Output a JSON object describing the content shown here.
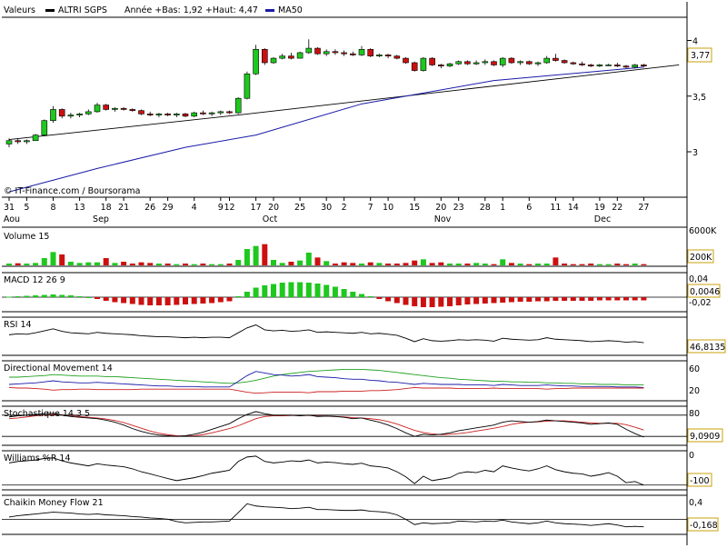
{
  "chart_data": {
    "type": "candlestick",
    "header": {
      "label": "Valeurs",
      "instrument": "ALTRI SGPS",
      "range_text": "Année +Bas: 1,92 +Haut: 4,47",
      "ma_label": "MA50"
    },
    "credit": "© IT-Finance.com / Boursorama",
    "colors": {
      "up": "#1ec81e",
      "down": "#cc1010",
      "ma": "#1a1aa8",
      "red_line": "#cc2020",
      "green_line": "#20a020"
    },
    "x_ticks": [
      "31",
      "5",
      "8",
      "13",
      "18",
      "21",
      "26",
      "29",
      "4",
      "9",
      "12",
      "17",
      "20",
      "25",
      "30",
      "2",
      "7",
      "10",
      "15",
      "20",
      "23",
      "28",
      "1",
      "6",
      "11",
      "14",
      "19",
      "22",
      "27"
    ],
    "months": [
      "Aou",
      "Sep",
      "Oct",
      "Nov",
      "Dec"
    ],
    "price": {
      "y_ticks": [
        "4",
        "3,5",
        "3"
      ],
      "ylim": [
        2.6,
        4.2
      ],
      "last_value": "3,77",
      "candles": [
        [
          3.07,
          3.12,
          3.04,
          3.1
        ],
        [
          3.1,
          3.12,
          3.07,
          3.09
        ],
        [
          3.09,
          3.11,
          3.07,
          3.1
        ],
        [
          3.1,
          3.16,
          3.1,
          3.15
        ],
        [
          3.15,
          3.29,
          3.14,
          3.28
        ],
        [
          3.28,
          3.41,
          3.26,
          3.38
        ],
        [
          3.38,
          3.39,
          3.3,
          3.32
        ],
        [
          3.32,
          3.35,
          3.3,
          3.33
        ],
        [
          3.33,
          3.35,
          3.31,
          3.34
        ],
        [
          3.34,
          3.38,
          3.33,
          3.36
        ],
        [
          3.36,
          3.44,
          3.35,
          3.42
        ],
        [
          3.42,
          3.43,
          3.37,
          3.38
        ],
        [
          3.38,
          3.4,
          3.36,
          3.39
        ],
        [
          3.39,
          3.4,
          3.37,
          3.38
        ],
        [
          3.38,
          3.39,
          3.36,
          3.37
        ],
        [
          3.37,
          3.38,
          3.33,
          3.34
        ],
        [
          3.34,
          3.36,
          3.32,
          3.33
        ],
        [
          3.33,
          3.35,
          3.31,
          3.34
        ],
        [
          3.34,
          3.35,
          3.32,
          3.33
        ],
        [
          3.33,
          3.35,
          3.31,
          3.34
        ],
        [
          3.34,
          3.35,
          3.31,
          3.32
        ],
        [
          3.32,
          3.36,
          3.31,
          3.35
        ],
        [
          3.35,
          3.37,
          3.33,
          3.34
        ],
        [
          3.34,
          3.36,
          3.32,
          3.35
        ],
        [
          3.35,
          3.37,
          3.33,
          3.36
        ],
        [
          3.36,
          3.37,
          3.34,
          3.35
        ],
        [
          3.35,
          3.49,
          3.34,
          3.48
        ],
        [
          3.48,
          3.72,
          3.47,
          3.7
        ],
        [
          3.7,
          3.96,
          3.69,
          3.92
        ],
        [
          3.92,
          3.93,
          3.78,
          3.8
        ],
        [
          3.8,
          3.85,
          3.79,
          3.84
        ],
        [
          3.84,
          3.88,
          3.83,
          3.86
        ],
        [
          3.86,
          3.89,
          3.83,
          3.84
        ],
        [
          3.84,
          3.9,
          3.84,
          3.89
        ],
        [
          3.89,
          4.01,
          3.88,
          3.93
        ],
        [
          3.93,
          3.94,
          3.87,
          3.88
        ],
        [
          3.88,
          3.92,
          3.86,
          3.9
        ],
        [
          3.9,
          3.92,
          3.87,
          3.89
        ],
        [
          3.89,
          3.91,
          3.86,
          3.88
        ],
        [
          3.88,
          3.9,
          3.86,
          3.87
        ],
        [
          3.87,
          3.95,
          3.86,
          3.92
        ],
        [
          3.92,
          3.93,
          3.85,
          3.86
        ],
        [
          3.86,
          3.88,
          3.85,
          3.87
        ],
        [
          3.87,
          3.88,
          3.84,
          3.86
        ],
        [
          3.86,
          3.87,
          3.83,
          3.84
        ],
        [
          3.84,
          3.85,
          3.79,
          3.8
        ],
        [
          3.8,
          3.81,
          3.72,
          3.73
        ],
        [
          3.73,
          3.85,
          3.72,
          3.84
        ],
        [
          3.84,
          3.85,
          3.77,
          3.78
        ],
        [
          3.78,
          3.79,
          3.75,
          3.77
        ],
        [
          3.77,
          3.8,
          3.76,
          3.79
        ],
        [
          3.79,
          3.82,
          3.78,
          3.81
        ],
        [
          3.81,
          3.82,
          3.78,
          3.79
        ],
        [
          3.79,
          3.82,
          3.78,
          3.8
        ],
        [
          3.8,
          3.83,
          3.78,
          3.81
        ],
        [
          3.81,
          3.82,
          3.77,
          3.78
        ],
        [
          3.78,
          3.85,
          3.76,
          3.84
        ],
        [
          3.84,
          3.85,
          3.79,
          3.8
        ],
        [
          3.8,
          3.82,
          3.78,
          3.81
        ],
        [
          3.81,
          3.82,
          3.78,
          3.79
        ],
        [
          3.79,
          3.81,
          3.77,
          3.8
        ],
        [
          3.8,
          3.86,
          3.79,
          3.84
        ],
        [
          3.84,
          3.88,
          3.81,
          3.82
        ],
        [
          3.82,
          3.83,
          3.79,
          3.8
        ],
        [
          3.8,
          3.81,
          3.78,
          3.79
        ],
        [
          3.79,
          3.81,
          3.77,
          3.78
        ],
        [
          3.78,
          3.79,
          3.76,
          3.77
        ],
        [
          3.77,
          3.79,
          3.76,
          3.78
        ],
        [
          3.78,
          3.79,
          3.77,
          3.78
        ],
        [
          3.78,
          3.8,
          3.76,
          3.77
        ],
        [
          3.77,
          3.78,
          3.75,
          3.76
        ],
        [
          3.76,
          3.79,
          3.75,
          3.78
        ],
        [
          3.78,
          3.79,
          3.76,
          3.77
        ]
      ],
      "ma50_endpoints": [
        [
          0,
          2.64
        ],
        [
          10,
          2.85
        ],
        [
          20,
          3.04
        ],
        [
          28,
          3.15
        ],
        [
          40,
          3.43
        ],
        [
          55,
          3.64
        ],
        [
          72,
          3.76
        ]
      ],
      "trend_line": [
        [
          0,
          3.11
        ],
        [
          26,
          3.33
        ],
        [
          76,
          3.78
        ]
      ]
    },
    "volume": {
      "label": "Volume 15",
      "y_ticks": [
        "6000K"
      ],
      "last_value": "200K",
      "max": 6000,
      "values": [
        300,
        350,
        300,
        400,
        1200,
        2200,
        1800,
        600,
        400,
        500,
        500,
        1200,
        400,
        600,
        300,
        500,
        400,
        300,
        300,
        200,
        300,
        200,
        300,
        200,
        200,
        300,
        900,
        2700,
        3200,
        3500,
        900,
        400,
        600,
        800,
        2100,
        1300,
        700,
        300,
        500,
        400,
        300,
        500,
        400,
        300,
        300,
        400,
        800,
        1000,
        400,
        500,
        300,
        300,
        300,
        400,
        300,
        200,
        1000,
        400,
        300,
        200,
        300,
        300,
        1300,
        300,
        200,
        200,
        300,
        200,
        200,
        300,
        200,
        300,
        200
      ]
    },
    "macd": {
      "label": "MACD 12 26 9",
      "y_ticks": [
        "0,04",
        "-0,02"
      ],
      "last_value": "0,0046",
      "ylim": [
        -0.03,
        0.05
      ],
      "values": [
        0.001,
        0.002,
        0.003,
        0.004,
        0.005,
        0.006,
        0.005,
        0.004,
        0.002,
        0.0,
        -0.004,
        -0.008,
        -0.011,
        -0.013,
        -0.015,
        -0.017,
        -0.018,
        -0.018,
        -0.018,
        -0.017,
        -0.016,
        -0.015,
        -0.014,
        -0.013,
        -0.011,
        -0.009,
        0.002,
        0.012,
        0.021,
        0.026,
        0.029,
        0.032,
        0.033,
        0.033,
        0.032,
        0.03,
        0.027,
        0.023,
        0.018,
        0.012,
        0.007,
        0.002,
        -0.004,
        -0.009,
        -0.013,
        -0.017,
        -0.02,
        -0.022,
        -0.022,
        -0.021,
        -0.02,
        -0.018,
        -0.016,
        -0.015,
        -0.014,
        -0.013,
        -0.012,
        -0.011,
        -0.01,
        -0.01,
        -0.009,
        -0.009,
        -0.008,
        -0.008,
        -0.008,
        -0.008,
        -0.008,
        -0.007,
        -0.007,
        -0.007,
        -0.007,
        -0.007,
        -0.007
      ]
    },
    "rsi": {
      "label": "RSI 14",
      "last_value": "46,8135",
      "ylim": [
        20,
        90
      ],
      "values": [
        58,
        60,
        59,
        62,
        66,
        70,
        65,
        62,
        61,
        60,
        63,
        61,
        60,
        59,
        58,
        56,
        55,
        54,
        54,
        53,
        52,
        53,
        52,
        53,
        53,
        52,
        62,
        72,
        78,
        68,
        66,
        67,
        65,
        66,
        68,
        63,
        64,
        63,
        62,
        61,
        63,
        60,
        61,
        59,
        57,
        51,
        44,
        50,
        46,
        45,
        46,
        48,
        47,
        48,
        47,
        45,
        51,
        49,
        48,
        47,
        48,
        52,
        49,
        48,
        47,
        46,
        44,
        45,
        46,
        45,
        43,
        44,
        42
      ]
    },
    "dmi": {
      "label": "Directional Movement 14",
      "y_ticks": [
        "60",
        "20"
      ],
      "ylim": [
        0,
        70
      ],
      "adx": [
        42,
        42,
        43,
        44,
        45,
        47,
        46,
        45,
        44,
        44,
        44,
        43,
        43,
        42,
        41,
        40,
        39,
        38,
        37,
        36,
        35,
        34,
        33,
        32,
        31,
        30,
        31,
        33,
        36,
        40,
        44,
        47,
        49,
        51,
        53,
        54,
        55,
        56,
        57,
        57,
        57,
        56,
        55,
        53,
        51,
        49,
        47,
        45,
        43,
        41,
        40,
        38,
        37,
        36,
        35,
        34,
        34,
        33,
        33,
        32,
        32,
        31,
        31,
        30,
        30,
        29,
        29,
        28,
        28,
        28,
        27,
        27,
        27
      ],
      "pdi": [
        28,
        29,
        30,
        31,
        33,
        35,
        33,
        32,
        31,
        31,
        32,
        31,
        30,
        29,
        28,
        27,
        26,
        25,
        25,
        24,
        24,
        24,
        23,
        23,
        23,
        23,
        34,
        45,
        53,
        50,
        47,
        46,
        44,
        45,
        47,
        43,
        42,
        41,
        39,
        38,
        38,
        36,
        35,
        33,
        32,
        30,
        28,
        30,
        29,
        28,
        28,
        28,
        27,
        27,
        27,
        26,
        28,
        27,
        26,
        26,
        26,
        27,
        26,
        25,
        25,
        24,
        24,
        24,
        24,
        23,
        23,
        23,
        22
      ],
      "mdi": [
        22,
        21,
        21,
        20,
        19,
        17,
        18,
        18,
        19,
        19,
        18,
        18,
        18,
        18,
        18,
        19,
        19,
        19,
        19,
        19,
        19,
        19,
        19,
        19,
        19,
        19,
        16,
        13,
        11,
        12,
        13,
        13,
        13,
        13,
        12,
        14,
        14,
        14,
        15,
        15,
        15,
        16,
        16,
        17,
        18,
        20,
        22,
        21,
        21,
        21,
        21,
        20,
        20,
        20,
        20,
        21,
        20,
        20,
        20,
        20,
        20,
        19,
        20,
        20,
        21,
        21,
        21,
        21,
        21,
        21,
        21,
        21,
        21
      ]
    },
    "stochastic": {
      "label": "Stochastique 14 3 5",
      "y_ticks": [
        "80"
      ],
      "last_value": "9,0909",
      "ylim": [
        0,
        100
      ],
      "k": [
        75,
        78,
        80,
        82,
        84,
        85,
        80,
        76,
        74,
        72,
        70,
        66,
        60,
        52,
        42,
        34,
        28,
        24,
        22,
        20,
        22,
        26,
        32,
        40,
        48,
        56,
        70,
        82,
        90,
        84,
        80,
        80,
        80,
        78,
        80,
        76,
        77,
        76,
        74,
        70,
        72,
        66,
        60,
        52,
        42,
        30,
        20,
        26,
        24,
        26,
        30,
        36,
        40,
        44,
        48,
        52,
        60,
        64,
        62,
        60,
        62,
        66,
        64,
        62,
        60,
        58,
        54,
        56,
        58,
        54,
        40,
        28,
        18
      ],
      "d": [
        70,
        72,
        75,
        78,
        80,
        82,
        81,
        79,
        76,
        74,
        72,
        69,
        65,
        59,
        51,
        43,
        35,
        29,
        25,
        22,
        21,
        22,
        25,
        30,
        36,
        42,
        50,
        60,
        70,
        76,
        78,
        78,
        79,
        79,
        79,
        78,
        77,
        76,
        75,
        73,
        72,
        70,
        67,
        62,
        55,
        46,
        37,
        31,
        27,
        25,
        26,
        28,
        31,
        35,
        39,
        43,
        48,
        54,
        58,
        60,
        61,
        63,
        64,
        64,
        62,
        60,
        58,
        57,
        57,
        57,
        53,
        46,
        38
      ]
    },
    "williams": {
      "label": "Williams %R 14",
      "y_ticks": [
        "0",
        "-100"
      ],
      "last_value": "-100",
      "ylim": [
        -110,
        10
      ],
      "values": [
        -25,
        -20,
        -18,
        -15,
        -10,
        -8,
        -18,
        -25,
        -30,
        -35,
        -28,
        -32,
        -35,
        -38,
        -45,
        -55,
        -62,
        -70,
        -78,
        -85,
        -80,
        -75,
        -68,
        -60,
        -55,
        -50,
        -20,
        -5,
        -2,
        -20,
        -25,
        -22,
        -18,
        -20,
        -15,
        -25,
        -22,
        -24,
        -28,
        -30,
        -26,
        -35,
        -38,
        -42,
        -55,
        -72,
        -95,
        -70,
        -85,
        -80,
        -75,
        -60,
        -55,
        -58,
        -50,
        -55,
        -35,
        -42,
        -48,
        -52,
        -45,
        -35,
        -48,
        -55,
        -60,
        -62,
        -70,
        -65,
        -58,
        -70,
        -92,
        -88,
        -100
      ]
    },
    "cmf": {
      "label": "Chaikin Money Flow 21",
      "y_ticks": [
        "0,4",
        "-0,168"
      ],
      "last_value": "-0,168",
      "ylim": [
        -0.3,
        0.5
      ],
      "values": [
        0.05,
        0.08,
        0.1,
        0.12,
        0.14,
        0.16,
        0.15,
        0.14,
        0.12,
        0.11,
        0.12,
        0.1,
        0.09,
        0.08,
        0.06,
        0.05,
        0.03,
        0.02,
        0.0,
        -0.05,
        -0.08,
        -0.07,
        -0.06,
        -0.06,
        -0.05,
        -0.04,
        0.15,
        0.35,
        0.3,
        0.28,
        0.27,
        0.26,
        0.24,
        0.25,
        0.27,
        0.22,
        0.22,
        0.21,
        0.2,
        0.2,
        0.21,
        0.18,
        0.17,
        0.15,
        0.1,
        0.0,
        -0.12,
        -0.08,
        -0.1,
        -0.09,
        -0.08,
        -0.04,
        -0.05,
        -0.06,
        -0.04,
        -0.05,
        -0.02,
        -0.06,
        -0.08,
        -0.1,
        -0.08,
        -0.04,
        -0.08,
        -0.1,
        -0.11,
        -0.12,
        -0.14,
        -0.12,
        -0.1,
        -0.13,
        -0.17,
        -0.16,
        -0.17
      ]
    }
  }
}
